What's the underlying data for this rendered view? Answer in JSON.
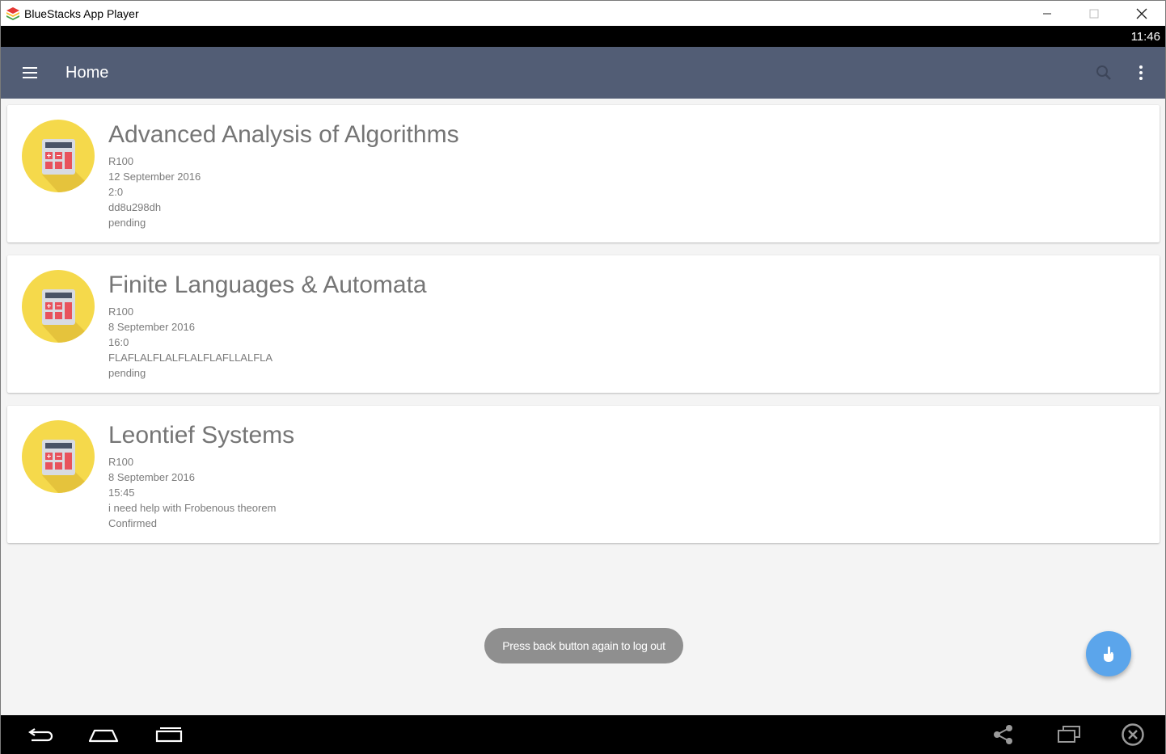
{
  "window": {
    "title": "BlueStacks App Player"
  },
  "statusbar": {
    "time": "11:46"
  },
  "toolbar": {
    "title": "Home"
  },
  "cards": [
    {
      "title": "Advanced Analysis of Algorithms",
      "amount": "R100",
      "date": "12 September 2016",
      "time": "2:0",
      "note": "dd8u298dh",
      "status": "pending"
    },
    {
      "title": "Finite Languages & Automata",
      "amount": "R100",
      "date": "8 September 2016",
      "time": "16:0",
      "note": "FLAFLALFLALFLALFLAFLLALFLA",
      "status": "pending"
    },
    {
      "title": "Leontief Systems",
      "amount": "R100",
      "date": "8 September 2016",
      "time": "15:45",
      "note": "i need help with Frobenous theorem",
      "status": "Confirmed"
    }
  ],
  "toast": {
    "message": "Press back button again to log out"
  },
  "colors": {
    "toolbar": "#525d75",
    "fab": "#5ba5eb",
    "icon_circle": "#f5d94b",
    "calculator_key": "#e8525c"
  },
  "icons": {
    "menu": "hamburger-icon",
    "search": "search-icon",
    "overflow": "more-vert-icon",
    "card": "calculator-icon",
    "fab": "hand-pointer-icon",
    "nav": [
      "back-icon",
      "home-icon",
      "recents-icon",
      "share-icon",
      "window-icon",
      "close-circle-icon"
    ]
  }
}
